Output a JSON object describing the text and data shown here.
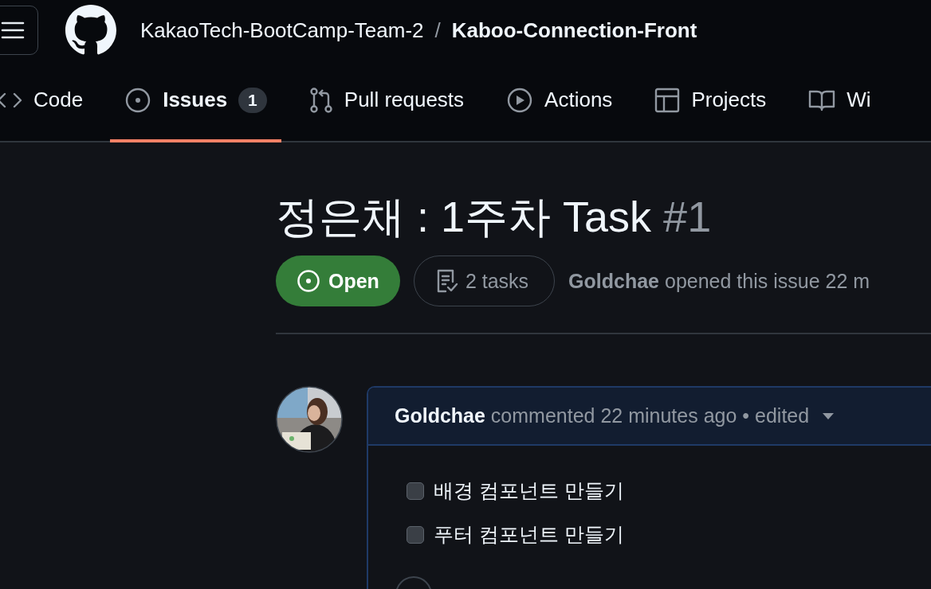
{
  "header": {
    "owner": "KakaoTech-BootCamp-Team-2",
    "separator": "/",
    "repo": "Kaboo-Connection-Front"
  },
  "tabs": [
    {
      "label": "Code",
      "kind": "code",
      "selected": false
    },
    {
      "label": "Issues",
      "kind": "issue",
      "count": "1",
      "selected": true
    },
    {
      "label": "Pull requests",
      "kind": "pull",
      "selected": false
    },
    {
      "label": "Actions",
      "kind": "play",
      "selected": false
    },
    {
      "label": "Projects",
      "kind": "table",
      "selected": false
    },
    {
      "label": "Wi",
      "kind": "book",
      "selected": false
    }
  ],
  "issue": {
    "title": "정은채 : 1주차 Task",
    "number": "#1",
    "state": "Open",
    "tasks": "2 tasks",
    "author": "Goldchae",
    "meta": "opened this issue 22 m"
  },
  "comment": {
    "author": "Goldchae",
    "meta": "commented 22 minutes ago • edited",
    "items": [
      {
        "text": "배경 컴포넌트 만들기",
        "checked": false
      },
      {
        "text": "푸터 컴포넌트 만들기",
        "checked": false
      }
    ]
  }
}
